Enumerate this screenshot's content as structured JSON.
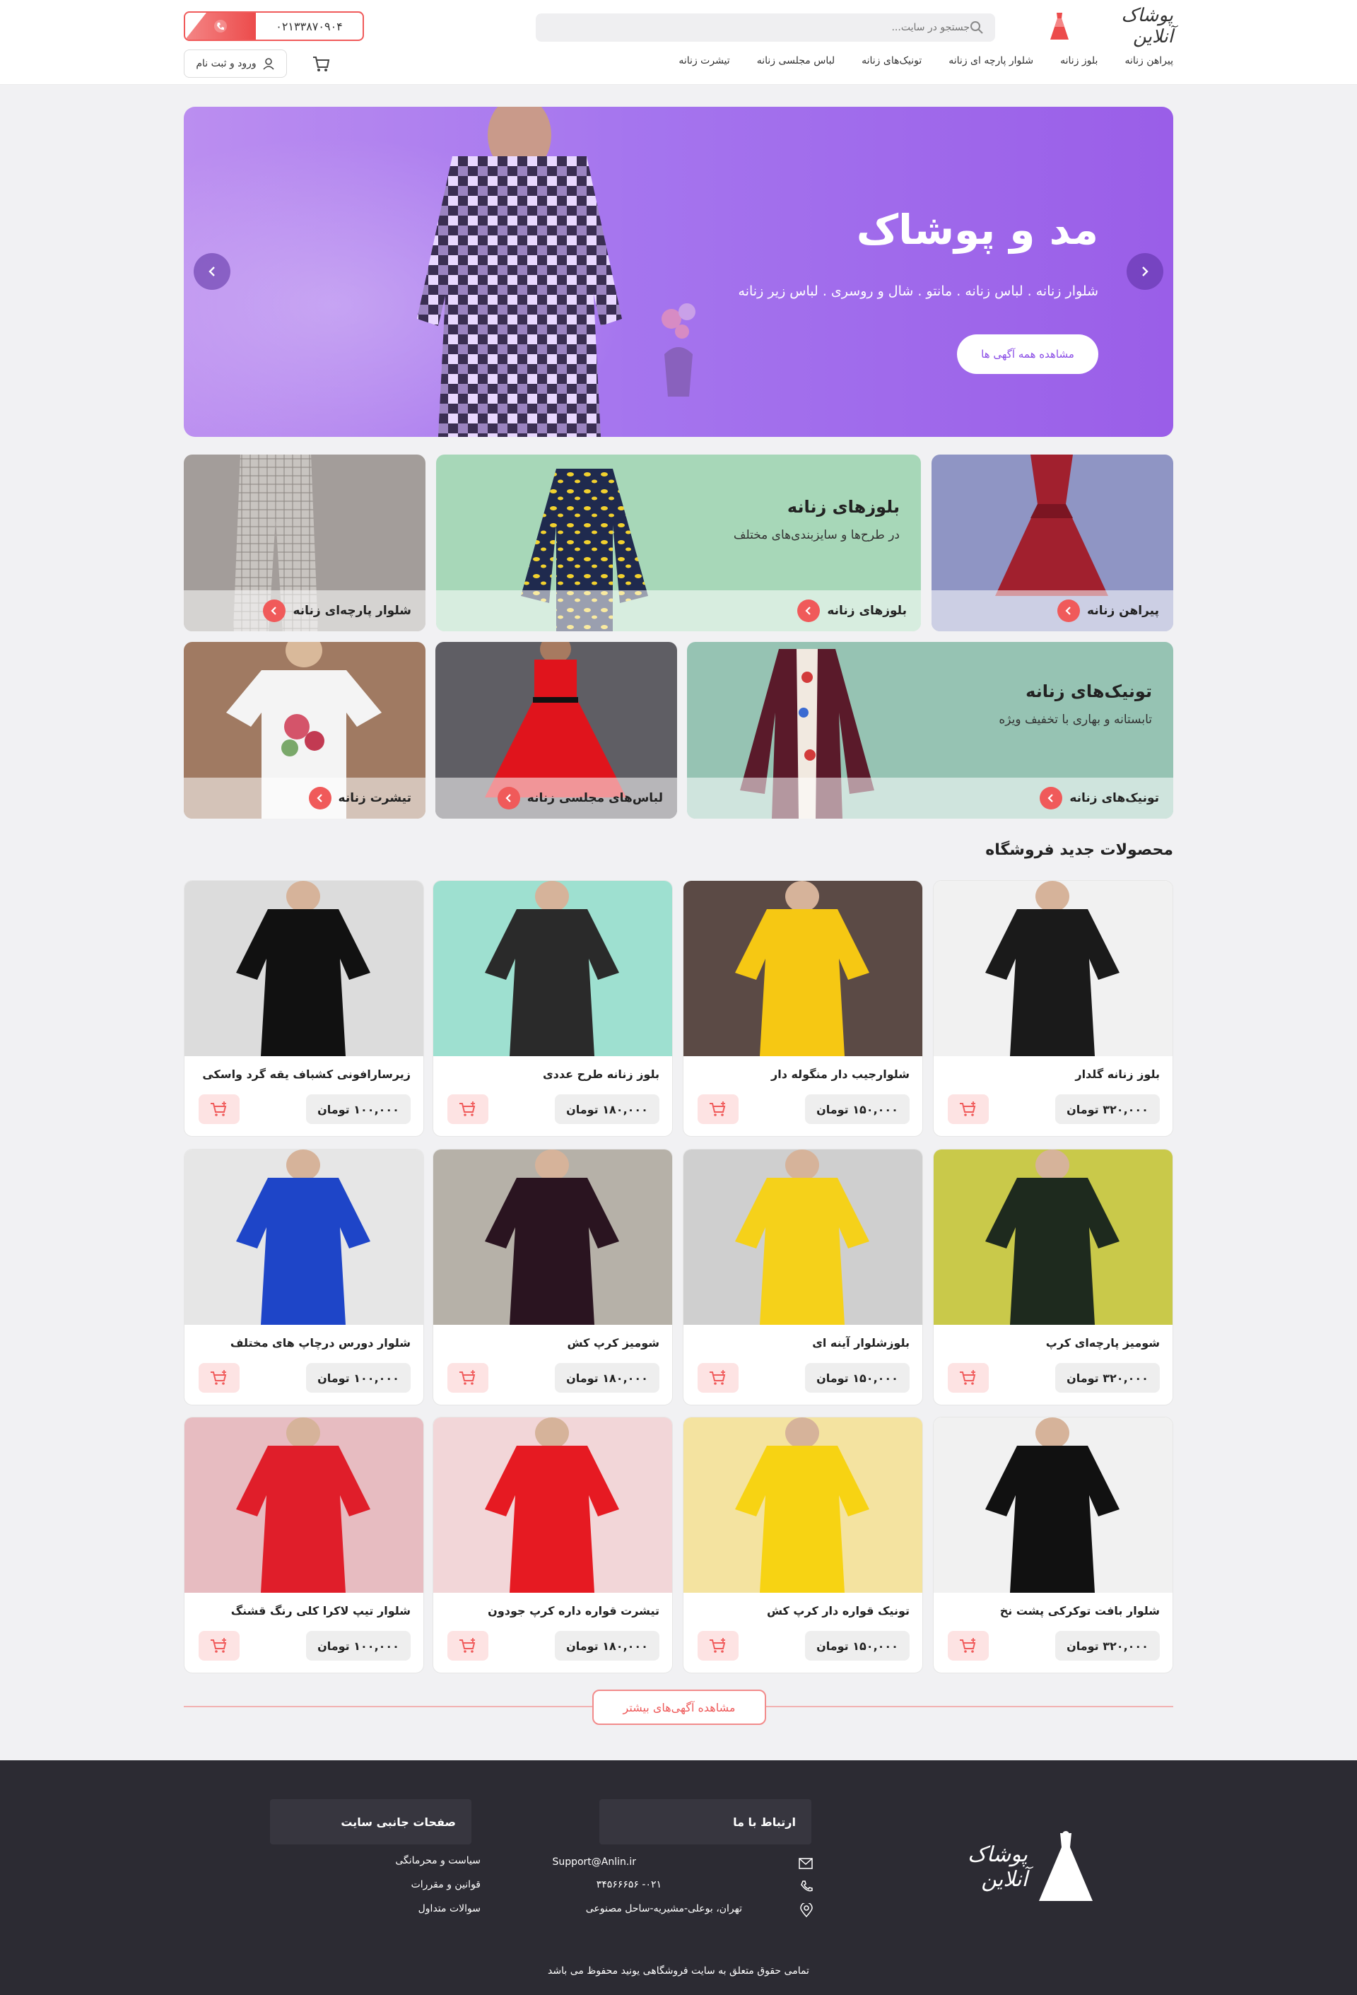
{
  "header": {
    "logo_text": "پوشاک آنلاین",
    "search_placeholder": "جستجو در سایت...",
    "phone": "۰۲۱۳۳۸۷۰۹۰۴",
    "login_label": "ورود و ثبت نام",
    "nav": [
      "پیراهن زنانه",
      "بلوز زنانه",
      "شلوار پارچه ای زنانه",
      "تونیک‌های زنانه",
      "لباس مجلسی زنانه",
      "تیشرت زنانه"
    ]
  },
  "hero": {
    "title": "مد و پوشاک",
    "subtitle": "شلوار زنانه . لباس زنانه . مانتو . شال و روسری . لباس زیر زنانه",
    "button": "مشاهده همه آگهی ها"
  },
  "categories": {
    "dress": "پیراهن زنانه",
    "blouse": "بلوزهای زنانه",
    "blouse_title": "بلوزهای زنانه",
    "blouse_sub": "در طرح‌ها و سایزبندی‌های مختلف",
    "pants": "شلوار پارچه‌ای زنانه",
    "tunic": "تونیک‌های زنانه",
    "tunic_title": "تونیک‌های زنانه",
    "tunic_sub": "تابستانه و بهاری با تخفیف ویژه",
    "party": "لباس‌های مجلسی زنانه",
    "tshirt": "تیشرت زنانه"
  },
  "products_title": "محصولات جدید فروشگاه",
  "products": [
    {
      "name": "بلوز زنانه گلدار",
      "price": "۳۲۰,۰۰۰ تومان"
    },
    {
      "name": "شلوارجیب دار منگوله دار",
      "price": "۱۵۰,۰۰۰ تومان"
    },
    {
      "name": "بلوز زنانه طرح عددی",
      "price": "۱۸۰,۰۰۰ تومان"
    },
    {
      "name": "زیرسارافونی کشباف یقه گرد واسکی",
      "price": "۱۰۰,۰۰۰ تومان"
    },
    {
      "name": "شومیز پارچه‌ای کرپ",
      "price": "۳۲۰,۰۰۰ تومان"
    },
    {
      "name": "بلوزشلوار آینه ای",
      "price": "۱۵۰,۰۰۰ تومان"
    },
    {
      "name": "شومیز کرپ کش",
      "price": "۱۸۰,۰۰۰ تومان"
    },
    {
      "name": "شلوار دورس درچاپ های مختلف",
      "price": "۱۰۰,۰۰۰ تومان"
    },
    {
      "name": "شلوار بافت توکرکی پشت نخ",
      "price": "۳۲۰,۰۰۰ تومان"
    },
    {
      "name": "تونیک قواره دار کرپ کش",
      "price": "۱۵۰,۰۰۰ تومان"
    },
    {
      "name": "تیشرت قواره داره کرپ جودون",
      "price": "۱۸۰,۰۰۰ تومان"
    },
    {
      "name": "شلوار تیپ لاکرا کلی رنگ قشنگ",
      "price": "۱۰۰,۰۰۰ تومان"
    }
  ],
  "more_button": "مشاهده آگهی‌های بیشتر",
  "footer": {
    "logo_text": "پوشاک آنلاین",
    "contact_title": "ارتباط با ما",
    "email": "Support@Anlin.ir",
    "phone": "۰۲۱- ۳۴۵۶۶۶۵۶",
    "address": "تهران، بوعلی-مشیریه-ساحل مصنوعی",
    "pages_title": "صفحات جانبی سایت",
    "links": [
      "سیاست و محرمانگی",
      "قوانین و مقررات",
      "سوالات متداول"
    ],
    "copyright": "تمامی حقوق متعلق به سایت فروشگاهی یونید محفوظ می باشد"
  },
  "colors": {
    "accent": "#f05a5a",
    "hero_purple": "#a575ee",
    "footer_bg": "#2c2b33"
  },
  "icons": {
    "search": "search-icon",
    "phone": "phone-icon",
    "user": "user-icon",
    "cart": "cart-icon",
    "arrow_left": "chevron-left-icon",
    "arrow_right": "chevron-right-icon",
    "mail": "mail-icon",
    "location": "location-icon"
  }
}
